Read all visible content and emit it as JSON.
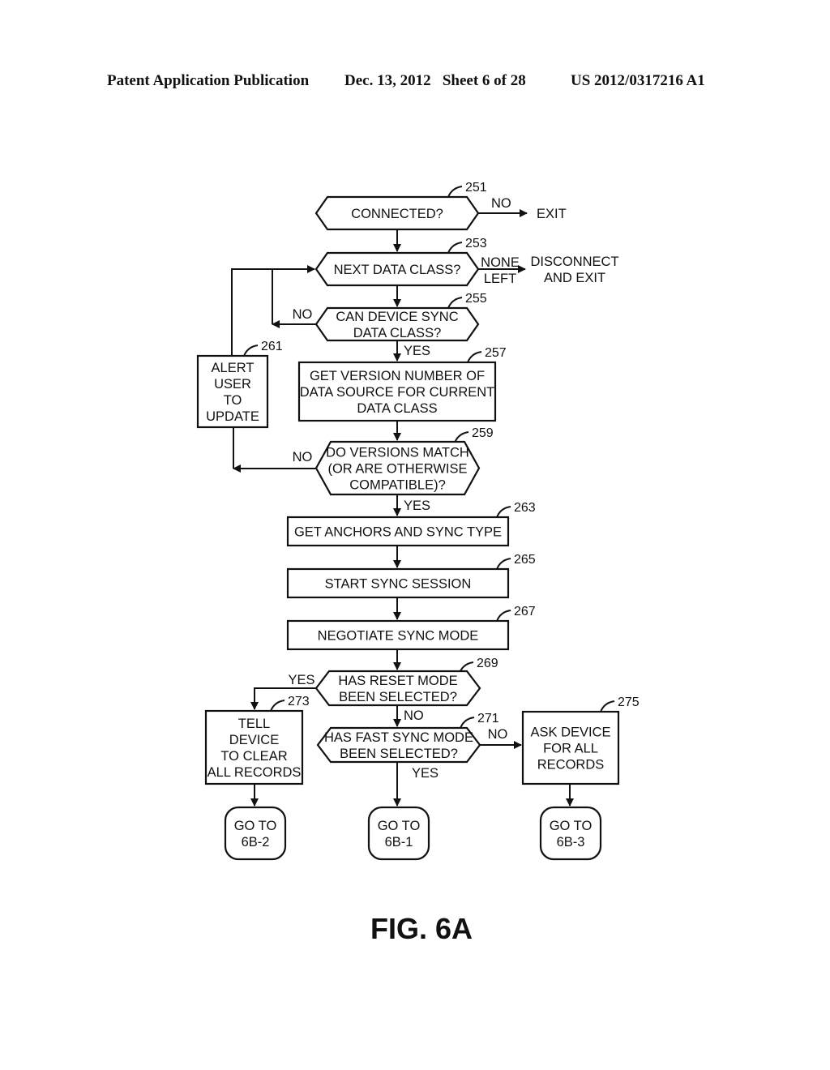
{
  "header": {
    "publication": "Patent Application Publication",
    "date_sheet": "Dec. 13, 2012   Sheet 6 of 28",
    "patent_number": "US 2012/0317216 A1"
  },
  "figure_label": "FIG. 6A",
  "nodes": {
    "n251": {
      "ref": "251",
      "lines": [
        "CONNECTED?"
      ]
    },
    "n253": {
      "ref": "253",
      "lines": [
        "NEXT DATA CLASS?"
      ]
    },
    "n255": {
      "ref": "255",
      "lines": [
        "CAN DEVICE SYNC",
        "DATA CLASS?"
      ]
    },
    "n257": {
      "ref": "257",
      "lines": [
        "GET VERSION NUMBER OF",
        "DATA SOURCE FOR CURRENT",
        "DATA CLASS"
      ]
    },
    "n259": {
      "ref": "259",
      "lines": [
        "DO VERSIONS MATCH",
        "(OR ARE OTHERWISE",
        "COMPATIBLE)?"
      ]
    },
    "n261": {
      "ref": "261",
      "lines": [
        "ALERT",
        "USER",
        "TO",
        "UPDATE"
      ]
    },
    "n263": {
      "ref": "263",
      "lines": [
        "GET ANCHORS AND SYNC TYPE"
      ]
    },
    "n265": {
      "ref": "265",
      "lines": [
        "START SYNC SESSION"
      ]
    },
    "n267": {
      "ref": "267",
      "lines": [
        "NEGOTIATE SYNC MODE"
      ]
    },
    "n269": {
      "ref": "269",
      "lines": [
        "HAS RESET MODE",
        "BEEN SELECTED?"
      ]
    },
    "n271": {
      "ref": "271",
      "lines": [
        "HAS FAST SYNC MODE",
        "BEEN SELECTED?"
      ]
    },
    "n273": {
      "ref": "273",
      "lines": [
        "TELL",
        "DEVICE",
        "TO CLEAR",
        "ALL RECORDS"
      ]
    },
    "n275": {
      "ref": "275",
      "lines": [
        "ASK DEVICE",
        "FOR ALL",
        "RECORDS"
      ]
    },
    "t1": {
      "lines": [
        "GO TO",
        "6B-2"
      ]
    },
    "t2": {
      "lines": [
        "GO TO",
        "6B-1"
      ]
    },
    "t3": {
      "lines": [
        "GO TO",
        "6B-3"
      ]
    },
    "exit": {
      "lines": [
        "EXIT"
      ]
    },
    "disconnect": {
      "lines": [
        "DISCONNECT",
        "AND EXIT"
      ]
    }
  },
  "edge_labels": {
    "e251_no": [
      "NO"
    ],
    "e253_none": [
      "NONE",
      "LEFT"
    ],
    "e255_no": [
      "NO"
    ],
    "e255_yes": [
      "YES"
    ],
    "e259_no": [
      "NO"
    ],
    "e259_yes": [
      "YES"
    ],
    "e269_yes": [
      "YES"
    ],
    "e269_no": [
      "NO"
    ],
    "e271_no": [
      "NO"
    ],
    "e271_yes": [
      "YES"
    ]
  }
}
